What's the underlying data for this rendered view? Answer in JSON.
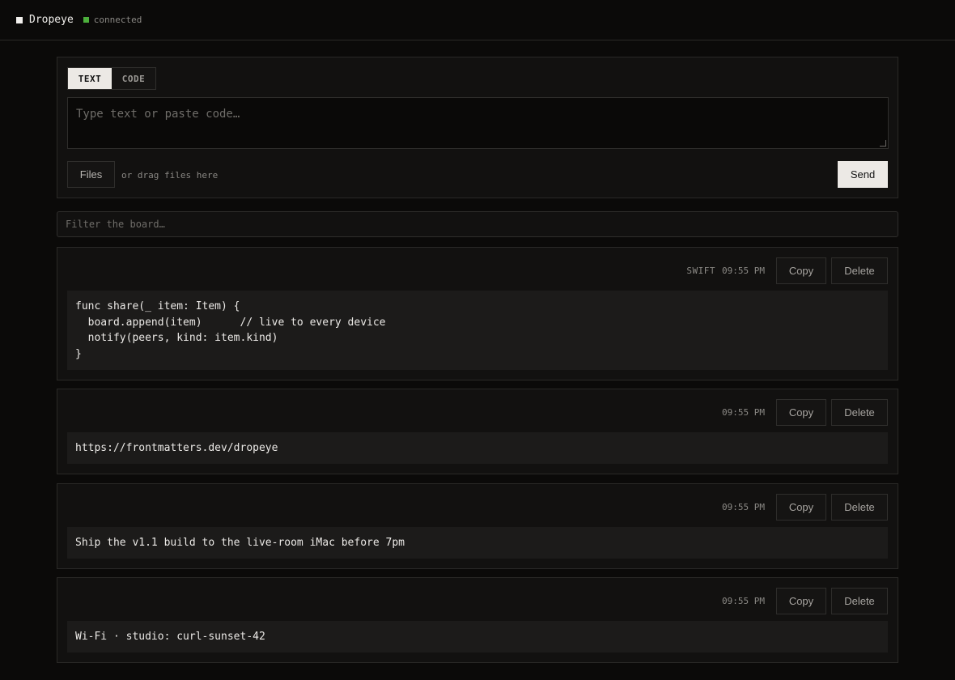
{
  "app": {
    "title": "Dropeye",
    "status": "connected",
    "status_color": "#4caf3c"
  },
  "composer": {
    "tabs": [
      {
        "label": "TEXT",
        "active": true
      },
      {
        "label": "CODE",
        "active": false
      }
    ],
    "placeholder": "Type text or paste code…",
    "files_label": "Files",
    "drag_hint": "or drag files here",
    "send_label": "Send"
  },
  "filter": {
    "placeholder": "Filter the board…"
  },
  "items": [
    {
      "lang": "SWIFT",
      "time": "09:55 PM",
      "copy_label": "Copy",
      "delete_label": "Delete",
      "content": "func share(_ item: Item) {\n  board.append(item)      // live to every device\n  notify(peers, kind: item.kind)\n}"
    },
    {
      "lang": "",
      "time": "09:55 PM",
      "copy_label": "Copy",
      "delete_label": "Delete",
      "content": "https://frontmatters.dev/dropeye"
    },
    {
      "lang": "",
      "time": "09:55 PM",
      "copy_label": "Copy",
      "delete_label": "Delete",
      "content": "Ship the v1.1 build to the live-room iMac before 7pm"
    },
    {
      "lang": "",
      "time": "09:55 PM",
      "copy_label": "Copy",
      "delete_label": "Delete",
      "content": "Wi-Fi · studio: curl-sunset-42"
    }
  ]
}
